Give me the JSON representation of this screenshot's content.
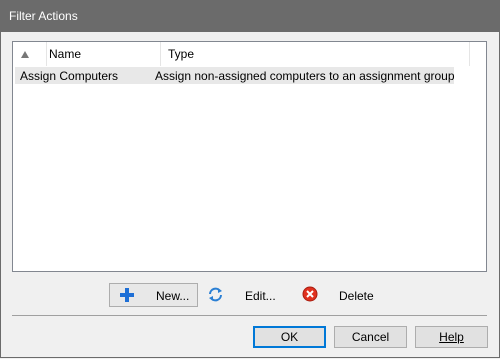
{
  "window": {
    "title": "Filter Actions"
  },
  "list": {
    "columns": {
      "name": "Name",
      "type": "Type"
    },
    "rows": [
      {
        "name": "Assign Computers",
        "type": "Assign non-assigned computers to an assignment group"
      }
    ]
  },
  "toolbar": {
    "new_label": "New...",
    "edit_label": "Edit...",
    "delete_label": "Delete"
  },
  "buttons": {
    "ok": "OK",
    "cancel": "Cancel",
    "help": "Help"
  },
  "icons": {
    "new": "plus-icon",
    "edit": "refresh-edit-icon",
    "delete": "delete-x-icon",
    "sort": "sort-triangle-icon"
  },
  "colors": {
    "titlebar": "#6b6b6b",
    "plus": "#1e6fd6",
    "delete": "#e0311f",
    "ok_border": "#0078d7"
  }
}
